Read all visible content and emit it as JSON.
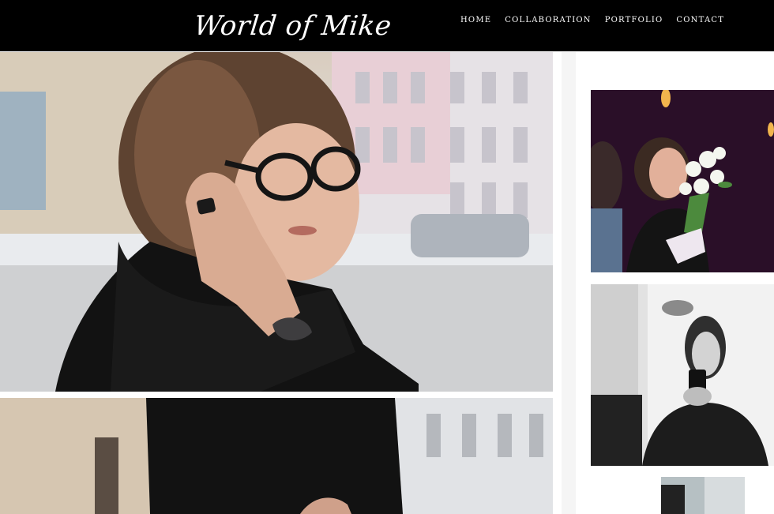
{
  "header": {
    "logo_text": "World of Mike",
    "nav": [
      {
        "label": "HOME"
      },
      {
        "label": "COLLABORATION"
      },
      {
        "label": "PORTFOLIO"
      },
      {
        "label": "CONTACT"
      }
    ]
  },
  "main": {
    "photos": [
      {
        "subject": "woman-with-glasses-photo"
      },
      {
        "subject": "woman-scarf-photo"
      }
    ]
  },
  "sidebar": {
    "photos": [
      {
        "subject": "party-flowers-photo"
      },
      {
        "subject": "mirror-selfie-photo"
      },
      {
        "subject": "thumbnail-photo"
      }
    ]
  },
  "colors": {
    "header_bg": "#000000",
    "nav_text": "#ffffff",
    "page_bg": "#ffffff"
  }
}
